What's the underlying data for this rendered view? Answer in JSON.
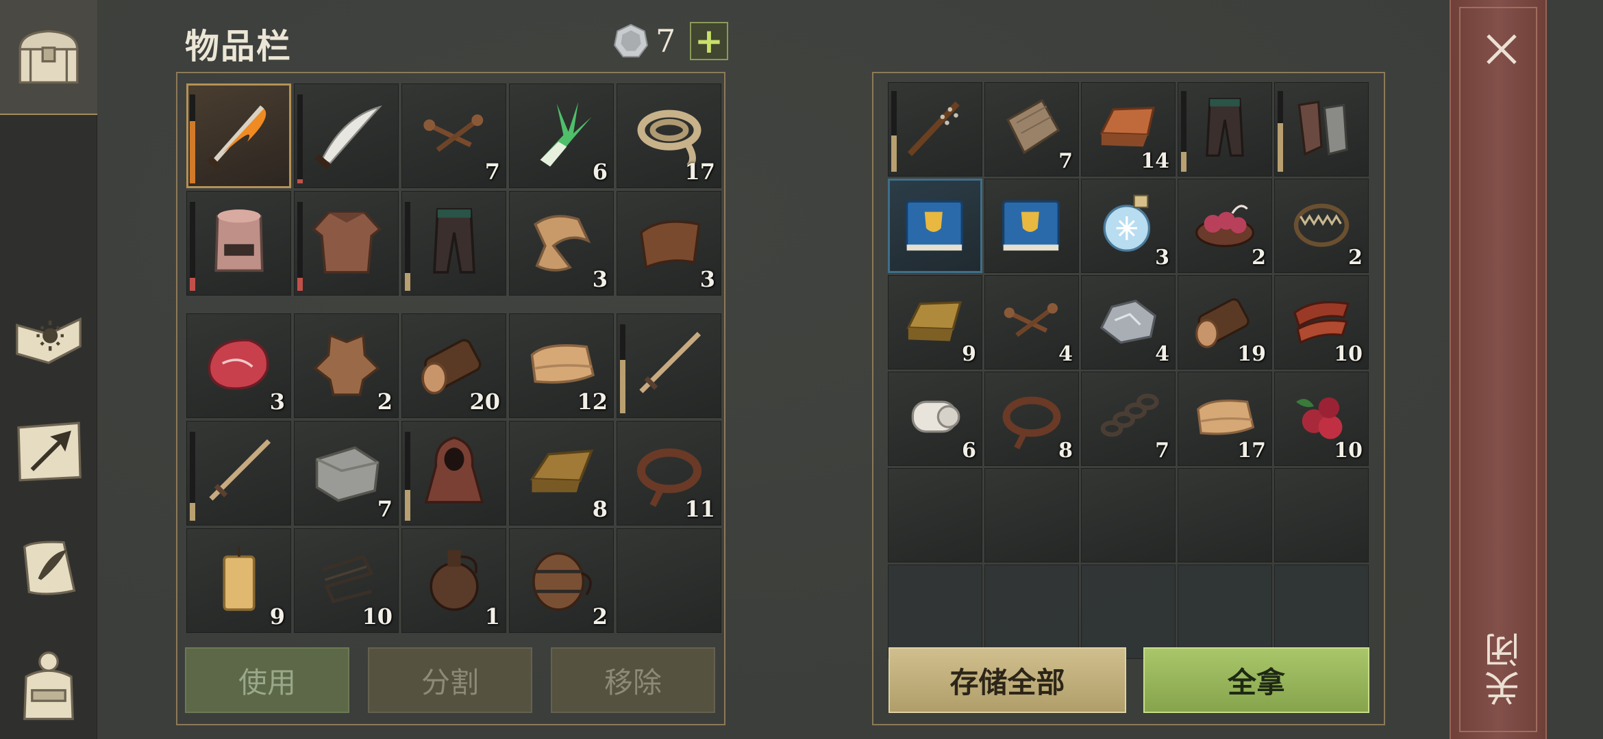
{
  "inventory": {
    "title": "物品栏",
    "currency_value": "7",
    "currency_icon": "silver-coin-icon",
    "plus_label": "+"
  },
  "sidebar": {
    "items": [
      {
        "name": "chest",
        "icon": "chest-icon",
        "active": true
      },
      {
        "name": "skills",
        "icon": "sun-book-icon",
        "active": false
      },
      {
        "name": "map",
        "icon": "map-arrow-icon",
        "active": false
      },
      {
        "name": "quests",
        "icon": "scroll-quill-icon",
        "active": false
      },
      {
        "name": "character",
        "icon": "backpack-icon",
        "active": false
      }
    ]
  },
  "player_equipment": [
    {
      "icon": "flaming-sword-icon",
      "qty": "",
      "durability": 0.7,
      "dura_color": "#d27a2a",
      "selected": true
    },
    {
      "icon": "scimitar-icon",
      "qty": "",
      "durability": 0.05,
      "dura_color": "#c2504a"
    },
    {
      "icon": "nails-icon",
      "qty": "7"
    },
    {
      "icon": "leek-icon",
      "qty": "6"
    },
    {
      "icon": "rope-icon",
      "qty": "17"
    },
    {
      "icon": "great-helm-icon",
      "qty": "",
      "durability": 0.15,
      "dura_color": "#c2504a"
    },
    {
      "icon": "chainmail-shirt-icon",
      "qty": "",
      "durability": 0.15,
      "dura_color": "#c2504a"
    },
    {
      "icon": "leather-pants-icon",
      "qty": "",
      "durability": 0.2,
      "dura_color": "#b8a070"
    },
    {
      "icon": "fabric-scrap-icon",
      "qty": "3"
    },
    {
      "icon": "leather-scrap-icon",
      "qty": "3"
    }
  ],
  "player_backpack": [
    {
      "icon": "raw-meat-icon",
      "qty": "3"
    },
    {
      "icon": "animal-hide-icon",
      "qty": "2"
    },
    {
      "icon": "log-icon",
      "qty": "20"
    },
    {
      "icon": "folded-cloth-icon",
      "qty": "12"
    },
    {
      "icon": "longsword-icon",
      "qty": "",
      "durability": 0.6,
      "dura_color": "#b8a070"
    },
    {
      "icon": "longsword-icon",
      "qty": "",
      "durability": 0.2,
      "dura_color": "#b8a070"
    },
    {
      "icon": "stone-block-icon",
      "qty": "7"
    },
    {
      "icon": "hooded-cloak-icon",
      "qty": "",
      "durability": 0.35,
      "dura_color": "#b8a070"
    },
    {
      "icon": "bronze-ingot-icon",
      "qty": "8"
    },
    {
      "icon": "leather-strips-icon",
      "qty": "11"
    },
    {
      "icon": "candle-icon",
      "qty": "9"
    },
    {
      "icon": "wire-icon",
      "qty": "10"
    },
    {
      "icon": "flask-icon",
      "qty": "1"
    },
    {
      "icon": "barrel-icon",
      "qty": "2"
    },
    {
      "icon": "empty",
      "qty": ""
    }
  ],
  "container": [
    {
      "icon": "spiked-club-icon",
      "qty": "",
      "durability": 0.45,
      "dura_color": "#b8a070"
    },
    {
      "icon": "wood-plank-icon",
      "qty": "7"
    },
    {
      "icon": "copper-ingot-icon",
      "qty": "14"
    },
    {
      "icon": "leather-pants-icon",
      "qty": "",
      "durability": 0.25,
      "dura_color": "#b8a070"
    },
    {
      "icon": "chainmail-gloves-icon",
      "qty": "",
      "durability": 0.6,
      "dura_color": "#b8a070"
    },
    {
      "icon": "blue-book-icon",
      "qty": "",
      "selected": true
    },
    {
      "icon": "blue-book-icon",
      "qty": ""
    },
    {
      "icon": "frost-potion-icon",
      "qty": "3"
    },
    {
      "icon": "guts-bowl-icon",
      "qty": "2"
    },
    {
      "icon": "bear-trap-icon",
      "qty": "2"
    },
    {
      "icon": "gold-ingot-icon",
      "qty": "9"
    },
    {
      "icon": "nails-icon",
      "qty": "4"
    },
    {
      "icon": "iron-ore-icon",
      "qty": "4"
    },
    {
      "icon": "log-icon",
      "qty": "19"
    },
    {
      "icon": "bacon-icon",
      "qty": "10"
    },
    {
      "icon": "cloth-roll-icon",
      "qty": "6"
    },
    {
      "icon": "leather-strips-icon",
      "qty": "8"
    },
    {
      "icon": "chain-icon",
      "qty": "7"
    },
    {
      "icon": "folded-cloth-icon",
      "qty": "17"
    },
    {
      "icon": "berries-icon",
      "qty": "10"
    },
    {
      "icon": "empty",
      "qty": ""
    },
    {
      "icon": "empty",
      "qty": ""
    },
    {
      "icon": "empty",
      "qty": ""
    },
    {
      "icon": "empty",
      "qty": ""
    },
    {
      "icon": "empty",
      "qty": ""
    },
    {
      "icon": "disabled",
      "qty": ""
    },
    {
      "icon": "disabled",
      "qty": ""
    },
    {
      "icon": "disabled",
      "qty": ""
    },
    {
      "icon": "disabled",
      "qty": ""
    },
    {
      "icon": "disabled",
      "qty": ""
    }
  ],
  "buttons": {
    "use": "使用",
    "split": "分割",
    "remove": "移除",
    "store_all": "存储全部",
    "take_all": "全拿",
    "close": "关闭"
  },
  "colors": {
    "panel_border": "#8c7a58",
    "take_green": "#a9c66a",
    "store_tan": "#c2b07e",
    "close_red": "#83504a"
  }
}
